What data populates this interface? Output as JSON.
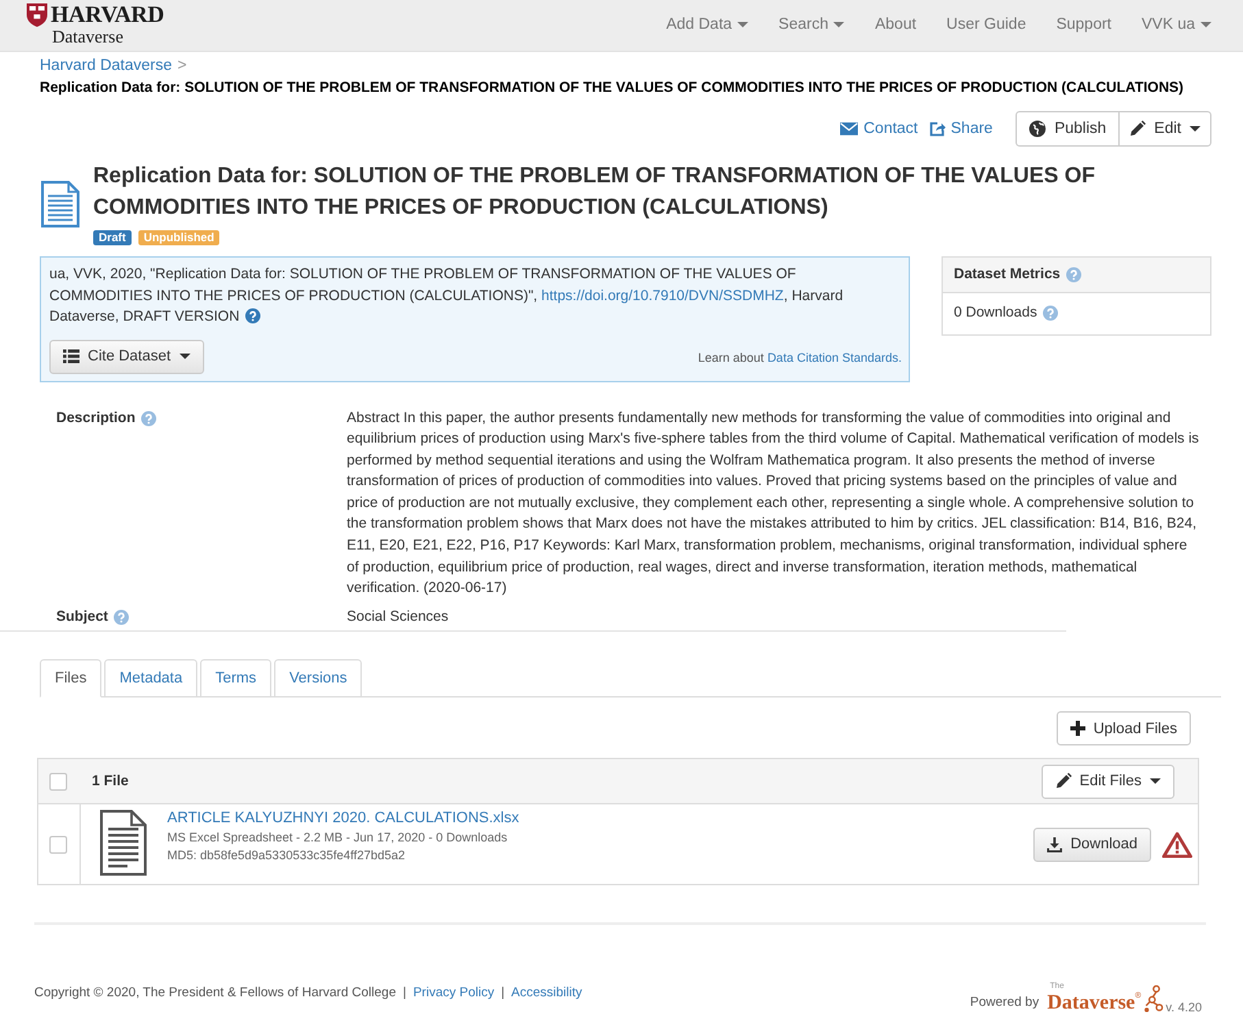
{
  "navbar": {
    "brand": {
      "title": "HARVARD",
      "subtitle": "Dataverse"
    },
    "items": [
      {
        "label": "Add Data",
        "dropdown": true
      },
      {
        "label": "Search",
        "dropdown": true
      },
      {
        "label": "About",
        "dropdown": false
      },
      {
        "label": "User Guide",
        "dropdown": false
      },
      {
        "label": "Support",
        "dropdown": false
      },
      {
        "label": "VVK ua",
        "dropdown": true
      }
    ]
  },
  "breadcrumb": {
    "items": [
      {
        "label": "Harvard Dataverse",
        "separator": ">"
      }
    ],
    "current": "Replication Data for: SOLUTION OF THE PROBLEM OF TRANSFORMATION OF THE VALUES OF COMMODITIES INTO THE PRICES OF PRODUCTION (CALCULATIONS)"
  },
  "actions": {
    "links": [
      {
        "kind": "contact",
        "label": "Contact"
      },
      {
        "kind": "share",
        "label": "Share"
      }
    ],
    "buttons": [
      {
        "kind": "publish",
        "label": "Publish",
        "dropdown": false
      },
      {
        "kind": "edit",
        "label": "Edit",
        "dropdown": true
      }
    ]
  },
  "dataset": {
    "title": "Replication Data for: SOLUTION OF THE PROBLEM OF TRANSFORMATION OF THE VALUES OF COMMODITIES INTO THE PRICES OF PRODUCTION (CALCULATIONS)",
    "badges": [
      {
        "label": "Draft",
        "color": "#337ab7"
      },
      {
        "label": "Unpublished",
        "color": "#f0ad4e"
      }
    ]
  },
  "citation": {
    "text_before": "ua, VVK, 2020, \"Replication Data for: SOLUTION OF THE PROBLEM OF TRANSFORMATION OF THE VALUES OF COMMODITIES INTO THE PRICES OF PRODUCTION (CALCULATIONS)\", ",
    "doi": "https://doi.org/10.7910/DVN/SSDMHZ",
    "text_after": ", Harvard Dataverse, DRAFT VERSION",
    "cite_button": {
      "label": "Cite Dataset",
      "dropdown": true
    },
    "standards_text": "Learn about",
    "standards_link": "Data Citation Standards."
  },
  "metrics": {
    "title": "Dataset Metrics",
    "downloads": "0 Downloads"
  },
  "metadata": [
    {
      "label": "Description",
      "value": "Abstract In this paper, the author presents fundamentally new methods for transforming the value of commodities into original and equilibrium prices of production using Marx's five-sphere tables from the third volume of Capital. Mathematical verification of models is performed by method sequential iterations and using the Wolfram Mathematica program. It also presents the method of inverse transformation of prices of production of commodities into values. Proved that pricing systems based on the principles of value and price of production are not mutually exclusive, they complement each other, representing a single whole. A comprehensive solution to the transformation problem shows that Marx does not have the mistakes attributed to him by critics. JEL classification: B14, B16, B24, E11, E20, E21, E22, P16, P17 Keywords: Karl Marx, transformation problem, mechanisms, original transformation, individual sphere of production, equilibrium price of production, real wages, direct and inverse transformation, iteration methods, mathematical verification. (2020-06-17)"
    },
    {
      "label": "Subject",
      "value": "Social Sciences"
    }
  ],
  "tabs": [
    {
      "label": "Files",
      "selected": true
    },
    {
      "label": "Metadata",
      "selected": false
    },
    {
      "label": "Terms",
      "selected": false
    },
    {
      "label": "Versions",
      "selected": false
    }
  ],
  "files": {
    "upload_button": "Upload Files",
    "select_all": {
      "checked": false
    },
    "count": "1 File",
    "edit_button": {
      "label": "Edit Files",
      "dropdown": true
    },
    "rows": [
      {
        "checked": false,
        "name": "ARTICLE KALYUZHNYI 2020. CALCULATIONS.xlsx",
        "info": "MS Excel Spreadsheet - 2.2 MB - Jun 17, 2020 - 0 Downloads",
        "md5": "MD5: db58fe5d9a5330533c35fe4ff27bd5a2",
        "download_button": "Download",
        "warning": true
      }
    ]
  },
  "footer": {
    "items": [
      {
        "kind": "text",
        "label": "Copyright © 2020, The President & Fellows of Harvard College"
      },
      {
        "kind": "separator",
        "label": "|"
      },
      {
        "kind": "link",
        "label": "Privacy Policy"
      },
      {
        "kind": "separator",
        "label": "|"
      },
      {
        "kind": "link",
        "label": "Accessibility"
      }
    ],
    "powered_by": "Powered by",
    "logo": {
      "small": "The",
      "name": "Dataverse",
      "mark": "®"
    },
    "version": "v. 4.20"
  }
}
